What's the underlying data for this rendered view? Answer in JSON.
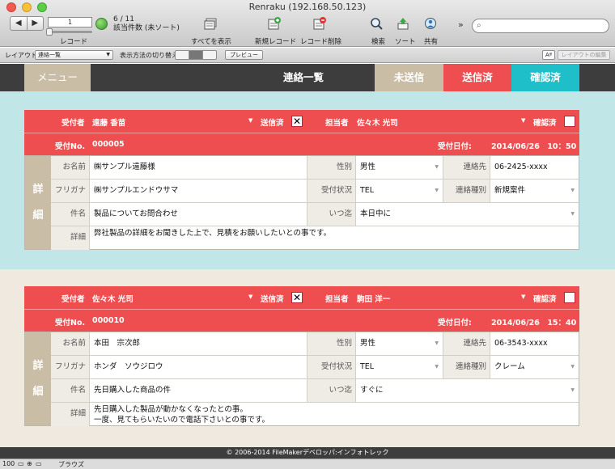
{
  "window": {
    "title": "Renraku (192.168.50.123)"
  },
  "toolbar": {
    "record_number": "1",
    "record_label": "レコード",
    "record_count": "6 / 11",
    "record_status": "該当件数 (未ソート)",
    "show_all": "すべてを表示",
    "new_record": "新規レコード",
    "delete_record": "レコード削除",
    "search": "検索",
    "sort": "ソート",
    "share": "共有",
    "more": "»"
  },
  "layout_bar": {
    "layout_label": "レイアウト:",
    "layout_value": "連絡一覧",
    "view_switch_label": "表示方法の切り替え:",
    "preview": "プレビュー",
    "aa": "Aª",
    "edit_layout": "レイアウトの編集"
  },
  "header": {
    "menu": "メニュー",
    "title": "連絡一覧",
    "unsent": "未送信",
    "sent": "送信済",
    "confirmed": "確認済"
  },
  "labels": {
    "receiver": "受付者",
    "sent": "送信済",
    "assignee": "担当者",
    "confirmed": "確認済",
    "receipt_no": "受付No.",
    "receipt_date": "受付日付:",
    "detail_chars": [
      "詳",
      "細"
    ],
    "name": "お名前",
    "gender": "性別",
    "contact": "連絡先",
    "furigana": "フリガナ",
    "status": "受付状況",
    "contact_type": "連絡種別",
    "subject": "件名",
    "deadline": "いつ迄",
    "detail": "詳細"
  },
  "records": [
    {
      "receiver": "遠藤 香苗",
      "sent_mark": "✕",
      "assignee": "佐々木 光司",
      "receipt_no": "000005",
      "receipt_date": "2014/06/26　10：50",
      "name": "㈱サンプル遠藤様",
      "gender": "男性",
      "contact": "06-2425-xxxx",
      "furigana": "㈱サンプルエンドウサマ",
      "status": "TEL",
      "contact_type": "新規案件",
      "subject": "製品についてお問合わせ",
      "deadline": "本日中に",
      "detail_line1": "弊社製品の詳細をお聞きした上で、見積をお願いしたいとの事です。",
      "detail_line2": ""
    },
    {
      "receiver": "佐々木 光司",
      "sent_mark": "✕",
      "assignee": "駒田 洋一",
      "receipt_no": "000010",
      "receipt_date": "2014/06/26　15：40",
      "name": "本田　宗次郎",
      "gender": "男性",
      "contact": "06-3543-xxxx",
      "furigana": "ホンダ　ソウジロウ",
      "status": "TEL",
      "contact_type": "クレーム",
      "subject": "先日購入した商品の件",
      "deadline": "すぐに",
      "detail_line1": "先日購入した製品が動かなくなったとの事。",
      "detail_line2": "一度、見てもらいたいので電話下さいとの事です。"
    }
  ],
  "footer": "© 2006-2014 FileMakerデベロッパ:インフォトレック",
  "statusbar": {
    "zoom": "100",
    "mode": "ブラウズ"
  },
  "colors": {
    "red": "#ee4e4f",
    "cyan": "#1fbfca",
    "beige": "#c9bda6",
    "dark": "#3d3d3d"
  }
}
